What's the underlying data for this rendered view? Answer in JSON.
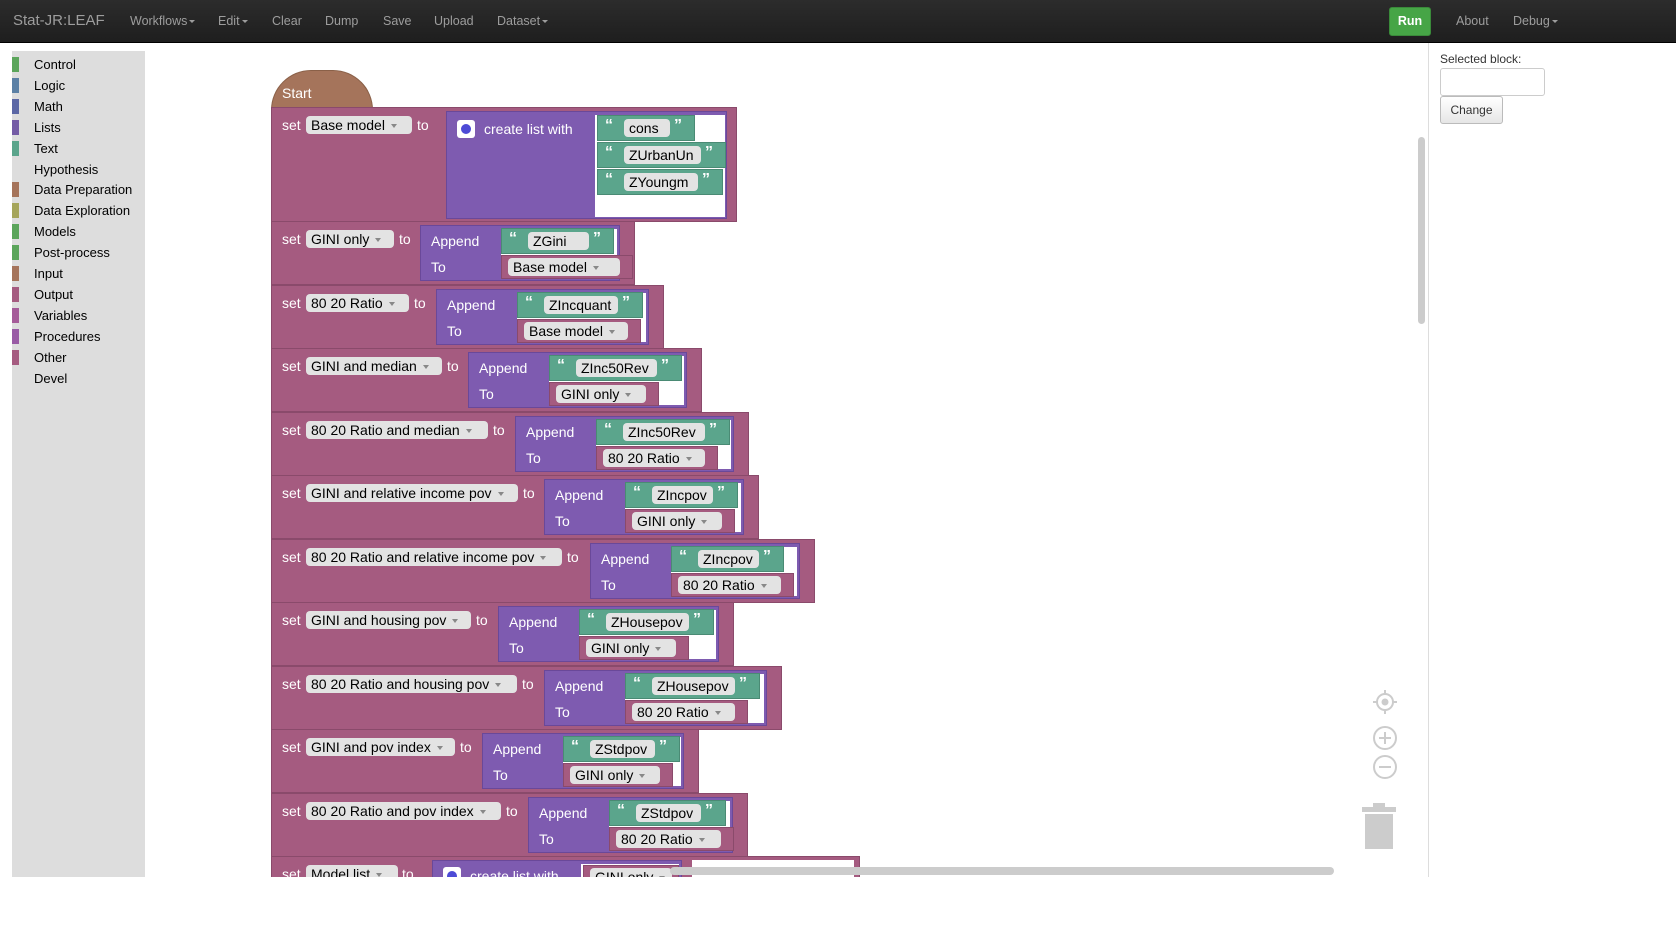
{
  "navbar": {
    "brand": "Stat-JR:LEAF",
    "items": [
      {
        "label": "Workflows",
        "caret": true
      },
      {
        "label": "Edit",
        "caret": true
      },
      {
        "label": "Clear"
      },
      {
        "label": "Dump"
      },
      {
        "label": "Save"
      },
      {
        "label": "Upload"
      },
      {
        "label": "Dataset",
        "caret": true
      }
    ],
    "run": "Run",
    "about": "About",
    "debug": "Debug"
  },
  "toolbox": [
    {
      "label": "Control",
      "color": "#5ba55b"
    },
    {
      "label": "Logic",
      "color": "#5b80a5"
    },
    {
      "label": "Math",
      "color": "#5b67a5"
    },
    {
      "label": "Lists",
      "color": "#745ba5"
    },
    {
      "label": "Text",
      "color": "#5ba58c"
    },
    {
      "label": "Hypothesis",
      "color": null
    },
    {
      "label": "Data Preparation",
      "color": "#a5745b"
    },
    {
      "label": "Data Exploration",
      "color": "#a5a55b"
    },
    {
      "label": "Models",
      "color": "#5ba55b"
    },
    {
      "label": "Post-process",
      "color": "#5ba55b"
    },
    {
      "label": "Input",
      "color": "#a5745b"
    },
    {
      "label": "Output",
      "color": "#a55b80"
    },
    {
      "label": "Variables",
      "color": "#a55b99"
    },
    {
      "label": "Procedures",
      "color": "#995ba5"
    },
    {
      "label": "Other",
      "color": "#a55b80"
    },
    {
      "label": "Devel",
      "color": null
    }
  ],
  "panel": {
    "selected_label": "Selected block:",
    "selected_value": "",
    "change": "Change"
  },
  "workspace": {
    "start": "Start",
    "kw_set": "set",
    "kw_to": "to",
    "kw_append": "Append",
    "kw_To": "To",
    "kw_create": "create list with",
    "base": {
      "var": "Base model",
      "items": [
        "cons",
        "ZUrbanUn",
        "ZYoungm"
      ]
    },
    "rows": [
      {
        "var": "GINI only",
        "text": "ZGini",
        "to": "Base model"
      },
      {
        "var": "80 20 Ratio",
        "text": "ZIncquant",
        "to": "Base model"
      },
      {
        "var": "GINI and median",
        "text": "ZInc50Rev",
        "to": "GINI only"
      },
      {
        "var": "80 20 Ratio and median",
        "text": "ZInc50Rev",
        "to": "80 20 Ratio"
      },
      {
        "var": "GINI and relative income pov",
        "text": "ZIncpov",
        "to": "GINI only"
      },
      {
        "var": "80 20 Ratio and relative income pov",
        "text": "ZIncpov",
        "to": "80 20 Ratio"
      },
      {
        "var": "GINI and housing pov",
        "text": "ZHousepov",
        "to": "GINI only"
      },
      {
        "var": "80 20 Ratio and housing pov",
        "text": "ZHousepov",
        "to": "80 20 Ratio"
      },
      {
        "var": "GINI and pov index",
        "text": "ZStdpov",
        "to": "GINI only"
      },
      {
        "var": "80 20 Ratio and pov index",
        "text": "ZStdpov",
        "to": "80 20 Ratio"
      }
    ],
    "last": {
      "var": "Model list",
      "create": "create list with",
      "item": "GINI only"
    }
  }
}
